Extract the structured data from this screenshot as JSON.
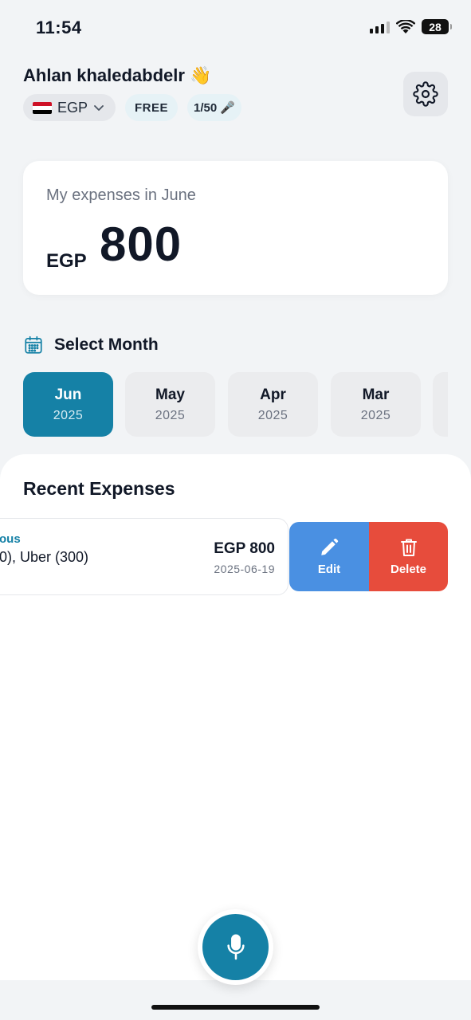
{
  "status_bar": {
    "time": "11:54",
    "battery_level": "28"
  },
  "header": {
    "greeting": "Ahlan khaledabdelr 👋",
    "currency": "EGP",
    "plan": "FREE",
    "usage": "1/50",
    "usage_icon": "🎤"
  },
  "summary": {
    "label": "My expenses in June",
    "currency": "EGP",
    "amount": "800"
  },
  "month_selector": {
    "title": "Select Month",
    "months": [
      {
        "name": "Jun",
        "year": "2025",
        "active": true
      },
      {
        "name": "May",
        "year": "2025",
        "active": false
      },
      {
        "name": "Apr",
        "year": "2025",
        "active": false
      },
      {
        "name": "Mar",
        "year": "2025",
        "active": false
      }
    ]
  },
  "recent_expenses": {
    "title": "Recent Expenses",
    "items": [
      {
        "category": "ous",
        "description": "0), Uber (300)",
        "amount": "EGP 800",
        "date": "2025-06-19"
      }
    ],
    "actions": {
      "edit_label": "Edit",
      "delete_label": "Delete"
    }
  },
  "colors": {
    "accent": "#1581a6",
    "edit": "#4a90e2",
    "delete": "#e74c3c",
    "background": "#f2f4f6"
  },
  "icons": {
    "settings": "gear-icon",
    "calendar": "calendar-icon",
    "mic": "microphone-icon",
    "edit": "pencil-icon",
    "delete": "trash-icon",
    "currency_dropdown": "chevron-down-icon"
  }
}
